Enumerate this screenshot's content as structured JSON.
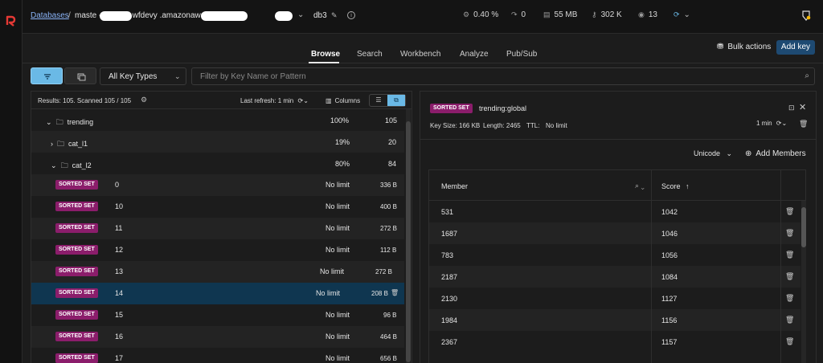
{
  "header": {
    "breadcrumb_databases": "Databases",
    "breadcrumb_separator": "/",
    "host_visible": "maste                -valkeycl.wfdevy                .amazonaws.com",
    "db_name": "db3",
    "stats": {
      "cpu": "0.40 %",
      "ops": "0",
      "memory": "55 MB",
      "keys": "302 K",
      "clients": "13"
    }
  },
  "tabs": [
    "Browse",
    "Search",
    "Workbench",
    "Analyze",
    "Pub/Sub"
  ],
  "actions": {
    "bulk": "Bulk actions",
    "add_key": "Add key"
  },
  "filter": {
    "key_types": "All Key Types",
    "search_placeholder": "Filter by Key Name or Pattern"
  },
  "list_header": {
    "results": "Results: 105. Scanned 105 / 105",
    "last_refresh": "Last refresh:  1 min",
    "columns": "Columns"
  },
  "tree": [
    {
      "label": "trending",
      "percent": "100%",
      "count": "105"
    },
    {
      "label": "cat_l1",
      "percent": "19%",
      "count": "20"
    },
    {
      "label": "cat_l2",
      "percent": "80%",
      "count": "84"
    }
  ],
  "keys": [
    {
      "type": "SORTED SET",
      "name": "0",
      "ttl": "No limit",
      "size": "336 B"
    },
    {
      "type": "SORTED SET",
      "name": "10",
      "ttl": "No limit",
      "size": "400 B"
    },
    {
      "type": "SORTED SET",
      "name": "11",
      "ttl": "No limit",
      "size": "272 B"
    },
    {
      "type": "SORTED SET",
      "name": "12",
      "ttl": "No limit",
      "size": "112 B"
    },
    {
      "type": "SORTED SET",
      "name": "13",
      "ttl": "No limit",
      "size": "272 B"
    },
    {
      "type": "SORTED SET",
      "name": "14",
      "ttl": "No limit",
      "size": "208 B"
    },
    {
      "type": "SORTED SET",
      "name": "15",
      "ttl": "No limit",
      "size": "96 B"
    },
    {
      "type": "SORTED SET",
      "name": "16",
      "ttl": "No limit",
      "size": "464 B"
    },
    {
      "type": "SORTED SET",
      "name": "17",
      "ttl": "No limit",
      "size": "656 B"
    }
  ],
  "details": {
    "type": "SORTED SET",
    "key": "trending:global",
    "key_size": "Key Size: 166 KB",
    "length": "Length: 2465",
    "ttl_label": "TTL:",
    "ttl_value": "No limit",
    "refresh": "1 min",
    "encoding": "Unicode",
    "add_members": "Add Members",
    "col_member": "Member",
    "col_score": "Score",
    "members": [
      {
        "member": "531",
        "score": "1042"
      },
      {
        "member": "1687",
        "score": "1046"
      },
      {
        "member": "783",
        "score": "1056"
      },
      {
        "member": "2187",
        "score": "1084"
      },
      {
        "member": "2130",
        "score": "1127"
      },
      {
        "member": "1984",
        "score": "1156"
      },
      {
        "member": "2367",
        "score": "1157"
      }
    ]
  },
  "colors": {
    "accent": "#6ab9e6",
    "badge": "#8b1d6b",
    "primary_button": "#1e4a72",
    "selected_row": "#0f3650"
  },
  "icons": [
    "redis-logo-icon",
    "pencil-icon",
    "info-icon",
    "cpu-icon",
    "ops-icon",
    "memory-icon",
    "key-icon",
    "clients-icon",
    "refresh-icon",
    "user-icon",
    "filter-icon",
    "tree-icon",
    "search-icon",
    "gear-icon",
    "columns-icon",
    "folder-icon",
    "trash-icon",
    "expand-icon",
    "close-icon",
    "sort-asc-icon",
    "plus-circle-icon"
  ]
}
